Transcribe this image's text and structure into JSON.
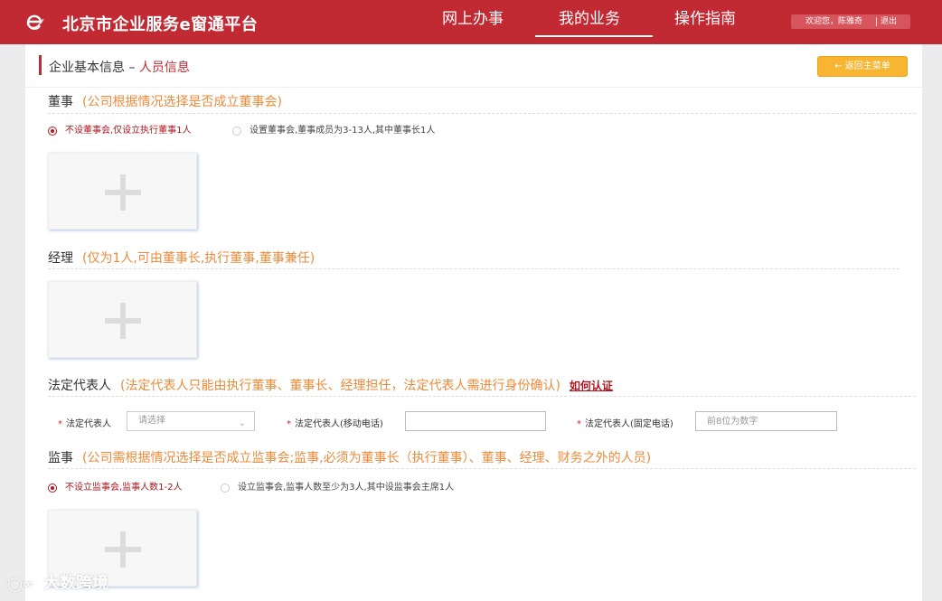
{
  "header": {
    "logo_text": "北京市企业服务e窗通平台",
    "nav": [
      {
        "label": "网上办事"
      },
      {
        "label": "我的业务",
        "active": true
      },
      {
        "label": "操作指南"
      }
    ],
    "welcome": "欢迎您，陈雅奇",
    "logout": "退出"
  },
  "breadcrumb": {
    "base": "企业基本信息",
    "sep": " – ",
    "current": "人员信息"
  },
  "back_button": "← 返回主菜单",
  "sections": {
    "board": {
      "title": "董事",
      "hint": "(公司根据情况选择是否成立董事会)",
      "options": [
        {
          "label": "不设董事会,仅设立执行董事1人",
          "selected": true
        },
        {
          "label": "设置董事会,董事成员为3-13人,其中董事长1人",
          "selected": false
        }
      ]
    },
    "manager": {
      "title": "经理",
      "hint": "(仅为1人,可由董事长,执行董事,董事兼任)"
    },
    "legal_rep": {
      "title": "法定代表人",
      "hint": "(法定代表人只能由执行董事、董事长、经理担任，法定代表人需进行身份确认)",
      "link": "如何认证",
      "fields": {
        "rep_label": "法定代表人",
        "rep_placeholder": "请选择",
        "mobile_label": "法定代表人(移动电话)",
        "mobile_value": "",
        "phone_label": "法定代表人(固定电话)",
        "phone_placeholder": "前8位为数字"
      }
    },
    "supervisor": {
      "title": "监事",
      "hint": "(公司需根据情况选择是否成立监事会;监事,必须为董事长（执行董事）、董事、经理、财务之外的人员)",
      "options": [
        {
          "label": "不设立监事会,监事人数1-2人",
          "selected": true
        },
        {
          "label": "设立监事会,监事人数至少为3人,其中设监事会主席1人",
          "selected": false
        }
      ]
    }
  },
  "watermark": "大数跨境",
  "colors": {
    "brand_red": "#c12a33",
    "hint_orange": "#f08a3a",
    "button_yellow": "#f7b531"
  }
}
